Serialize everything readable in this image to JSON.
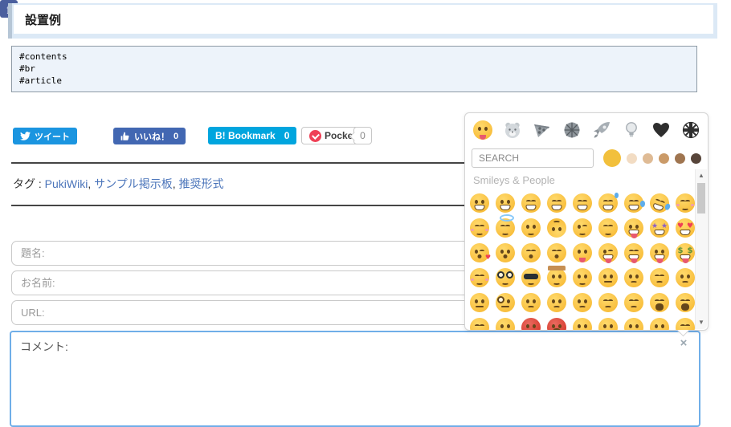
{
  "page": {
    "title": "設置例"
  },
  "code_block": {
    "lines": [
      "#contents",
      "#br",
      "#article"
    ]
  },
  "share_bar": {
    "tweet": {
      "label": "ツイート"
    },
    "facebook": {
      "letter": "f"
    },
    "like": {
      "label": "いいね！",
      "count": "0"
    },
    "hatena": {
      "label": "B! Bookmark",
      "count": "0"
    },
    "pocket": {
      "label": "Pocket",
      "count": "0"
    }
  },
  "tags": {
    "prefix": "タグ :",
    "items": [
      "PukiWiki",
      "サンプル掲示板",
      "推奨形式"
    ]
  },
  "form": {
    "subject_placeholder": "題名:",
    "name_placeholder": "お名前:",
    "url_placeholder": "URL:",
    "comment_placeholder": "コメント:",
    "close_button": "×"
  },
  "emoji_picker": {
    "search_placeholder": "SEARCH",
    "category_label": "Smileys & People",
    "tabs": [
      "smileys-people",
      "animals-nature",
      "food-drink",
      "activity",
      "travel-places",
      "objects",
      "symbols",
      "flags"
    ],
    "tones": [
      "#f2c03c",
      "#f2dcc3",
      "#dfbb95",
      "#ca9a68",
      "#9f7550",
      "#57453a"
    ],
    "grid": [
      {
        "ch": "😀",
        "name": "grinning-face",
        "v": "mg"
      },
      {
        "ch": "😃",
        "name": "grinning-face-big-eyes",
        "v": "mg"
      },
      {
        "ch": "😄",
        "name": "grinning-face-smiling-eyes",
        "v": "ec mg"
      },
      {
        "ch": "😁",
        "name": "beaming-face",
        "v": "ec mg"
      },
      {
        "ch": "😆",
        "name": "grinning-squinting-face",
        "v": "ec mg"
      },
      {
        "ch": "😅",
        "name": "grinning-face-with-sweat",
        "v": "ec mg sw"
      },
      {
        "ch": "😂",
        "name": "face-with-tears-of-joy",
        "v": "ec mg tr"
      },
      {
        "ch": "🤣",
        "name": "rolling-on-the-floor-laughing",
        "v": "ec mg tr tilt"
      },
      {
        "ch": "☺",
        "name": "smiling-face",
        "v": "ec ms bl"
      },
      {
        "ch": "😊",
        "name": "smiling-face-smiling-eyes",
        "v": "ec ms bl"
      },
      {
        "ch": "😇",
        "name": "smiling-face-with-halo",
        "v": "ec ms hl"
      },
      {
        "ch": "🙂",
        "name": "slightly-smiling-face",
        "v": "ms"
      },
      {
        "ch": "🙃",
        "name": "upside-down-face",
        "v": "ms flip"
      },
      {
        "ch": "😉",
        "name": "winking-face",
        "v": "wk ms"
      },
      {
        "ch": "😌",
        "name": "relieved-face",
        "v": "ec ms"
      },
      {
        "ch": "🤪",
        "name": "zany-face",
        "v": "mg tg"
      },
      {
        "ch": "🤩",
        "name": "star-struck",
        "v": "es mg"
      },
      {
        "ch": "😍",
        "name": "smiling-face-heart-eyes",
        "v": "eh mg"
      },
      {
        "ch": "😘",
        "name": "face-blowing-a-kiss",
        "v": "wk mk hr2m"
      },
      {
        "ch": "😗",
        "name": "kissing-face",
        "v": "mk"
      },
      {
        "ch": "😙",
        "name": "kissing-face-smiling-eyes",
        "v": "ec mk"
      },
      {
        "ch": "😚",
        "name": "kissing-face-closed-eyes",
        "v": "ec mk"
      },
      {
        "ch": "😋",
        "name": "face-savoring-food",
        "v": "ms tg"
      },
      {
        "ch": "😜",
        "name": "winking-face-with-tongue",
        "v": "wk mg tg"
      },
      {
        "ch": "😝",
        "name": "squinting-face-with-tongue",
        "v": "ec mg tg"
      },
      {
        "ch": "😛",
        "name": "face-with-tongue",
        "v": "mg tg"
      },
      {
        "ch": "🤑",
        "name": "money-mouth-face",
        "v": "ed mg tg"
      },
      {
        "ch": "🤗",
        "name": "hugging-face",
        "v": "ec ms bl"
      },
      {
        "ch": "🤓",
        "name": "nerd-face",
        "v": "gl ms"
      },
      {
        "ch": "😎",
        "name": "smiling-face-with-sunglasses",
        "v": "eg ms"
      },
      {
        "ch": "🤠",
        "name": "cowboy-hat-face",
        "v": "ms ht"
      },
      {
        "ch": "😏",
        "name": "smirking-face",
        "v": "ms"
      },
      {
        "ch": "😒",
        "name": "unamused-face",
        "v": "mn"
      },
      {
        "ch": "😞",
        "name": "disappointed-face",
        "v": "mf"
      },
      {
        "ch": "😔",
        "name": "pensive-face",
        "v": "ec mf"
      },
      {
        "ch": "😟",
        "name": "worried-face",
        "v": "mf"
      },
      {
        "ch": "🤨",
        "name": "face-with-raised-eyebrow",
        "v": "mn"
      },
      {
        "ch": "🧐",
        "name": "face-with-monocle",
        "v": "mc mn"
      },
      {
        "ch": "😕",
        "name": "confused-face",
        "v": "mf"
      },
      {
        "ch": "🙁",
        "name": "slightly-frowning-face",
        "v": "mf"
      },
      {
        "ch": "☹",
        "name": "frowning-face",
        "v": "mf"
      },
      {
        "ch": "😣",
        "name": "persevering-face",
        "v": "ec mf"
      },
      {
        "ch": "😖",
        "name": "confounded-face",
        "v": "ec mf"
      },
      {
        "ch": "😫",
        "name": "tired-face",
        "v": "ec mw"
      },
      {
        "ch": "😩",
        "name": "weary-face",
        "v": "ec mw"
      },
      {
        "ch": "😤",
        "name": "face-with-steam-from-nose",
        "v": "ec mn"
      },
      {
        "ch": "😠",
        "name": "angry-face",
        "v": "mf"
      },
      {
        "ch": "😡",
        "name": "pouting-face",
        "v": "rd mf"
      },
      {
        "ch": "🤬",
        "name": "face-with-symbols-on-mouth",
        "v": "rd mw"
      },
      {
        "ch": "😷",
        "name": "face-with-medical-mask",
        "v": "mn"
      },
      {
        "ch": "🤒",
        "name": "face-with-thermometer",
        "v": "mn"
      },
      {
        "ch": "🤕",
        "name": "face-with-head-bandage",
        "v": "mn"
      },
      {
        "ch": "🤢",
        "name": "nauseated-face",
        "v": "mn"
      },
      {
        "ch": "🤧",
        "name": "sneezing-face",
        "v": "ec mn"
      }
    ]
  }
}
